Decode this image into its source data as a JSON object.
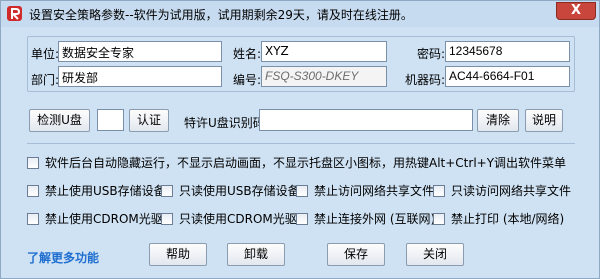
{
  "window": {
    "title": "设置安全策略参数--软件为试用版，试用期剩余29天，请及时在线注册。",
    "close_symbol": "X"
  },
  "form": {
    "unit_label": "单位:",
    "unit_value": "数据安全专家",
    "name_label": "姓名:",
    "name_value": "XYZ",
    "password_label": "密码:",
    "password_value": "12345678",
    "dept_label": "部门:",
    "dept_value": "研发部",
    "serial_label": "编号:",
    "serial_value": "FSQ-S300-DKEY",
    "machine_label": "机器码:",
    "machine_value": "AC44-6664-F01"
  },
  "usb": {
    "detect_button": "检测U盘",
    "code_value": "",
    "auth_button": "认证",
    "id_label": "特许U盘识别码:",
    "id_value": "",
    "clear_button": "清除",
    "help_button": "说明"
  },
  "options": [
    {
      "label": "软件后台自动隐藏运行，不显示启动画面，不显示托盘区小图标，用热键Alt+Ctrl+Y调出软件菜单"
    },
    {
      "label": "禁止使用USB存储设备"
    },
    {
      "label": "只读使用USB存储设备"
    },
    {
      "label": "禁止访问网络共享文件"
    },
    {
      "label": "只读访问网络共享文件"
    },
    {
      "label": "禁止使用CDROM光驱"
    },
    {
      "label": "只读使用CDROM光驱"
    },
    {
      "label": "禁止连接外网 (互联网)"
    },
    {
      "label": "禁止打印 (本地/网络)"
    }
  ],
  "footer": {
    "learn_more": "了解更多功能",
    "help_button": "帮助",
    "uninstall_button": "卸载",
    "save_button": "保存",
    "close_button": "关闭"
  },
  "colors": {
    "background": "#cfe2f3",
    "link": "#1f6fd0",
    "close": "#c9463d"
  }
}
